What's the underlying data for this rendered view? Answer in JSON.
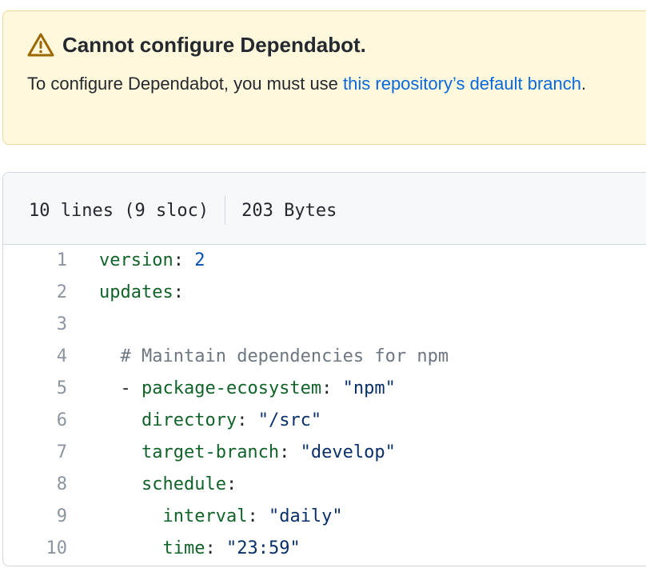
{
  "flash": {
    "title": "Cannot configure Dependabot.",
    "body_prefix": "To configure Dependabot, you must use ",
    "link_text": "this repository’s default branch",
    "body_suffix": ".",
    "icon": "alert-icon",
    "colors": {
      "background": "#fff8dc",
      "border": "#ecdba0",
      "icon": "#9a6700",
      "link": "#0969da"
    }
  },
  "file": {
    "lines_info": "10 lines (9 sloc)",
    "size": "203 Bytes"
  },
  "code": {
    "colors": {
      "key": "#116329",
      "number": "#0550ae",
      "string": "#0a3069",
      "comment": "#6e7781",
      "line_number": "#8c959f"
    },
    "lines": [
      {
        "number": "1",
        "indent": "",
        "tokens": [
          {
            "t": "k",
            "v": "version"
          },
          {
            "t": "p",
            "v": ": "
          },
          {
            "t": "n",
            "v": "2"
          }
        ]
      },
      {
        "number": "2",
        "indent": "",
        "tokens": [
          {
            "t": "k",
            "v": "updates"
          },
          {
            "t": "p",
            "v": ":"
          }
        ]
      },
      {
        "number": "3",
        "indent": "",
        "tokens": []
      },
      {
        "number": "4",
        "indent": "  ",
        "tokens": [
          {
            "t": "c",
            "v": "# Maintain dependencies for npm"
          }
        ]
      },
      {
        "number": "5",
        "indent": "  ",
        "tokens": [
          {
            "t": "p",
            "v": "- "
          },
          {
            "t": "k",
            "v": "package-ecosystem"
          },
          {
            "t": "p",
            "v": ": "
          },
          {
            "t": "s",
            "v": "\"npm\""
          }
        ]
      },
      {
        "number": "6",
        "indent": "    ",
        "tokens": [
          {
            "t": "k",
            "v": "directory"
          },
          {
            "t": "p",
            "v": ": "
          },
          {
            "t": "s",
            "v": "\"/src\""
          }
        ]
      },
      {
        "number": "7",
        "indent": "    ",
        "tokens": [
          {
            "t": "k",
            "v": "target-branch"
          },
          {
            "t": "p",
            "v": ": "
          },
          {
            "t": "s",
            "v": "\"develop\""
          }
        ]
      },
      {
        "number": "8",
        "indent": "    ",
        "tokens": [
          {
            "t": "k",
            "v": "schedule"
          },
          {
            "t": "p",
            "v": ":"
          }
        ]
      },
      {
        "number": "9",
        "indent": "      ",
        "tokens": [
          {
            "t": "k",
            "v": "interval"
          },
          {
            "t": "p",
            "v": ": "
          },
          {
            "t": "s",
            "v": "\"daily\""
          }
        ]
      },
      {
        "number": "10",
        "indent": "      ",
        "tokens": [
          {
            "t": "k",
            "v": "time"
          },
          {
            "t": "p",
            "v": ": "
          },
          {
            "t": "s",
            "v": "\"23:59\""
          }
        ]
      }
    ]
  }
}
